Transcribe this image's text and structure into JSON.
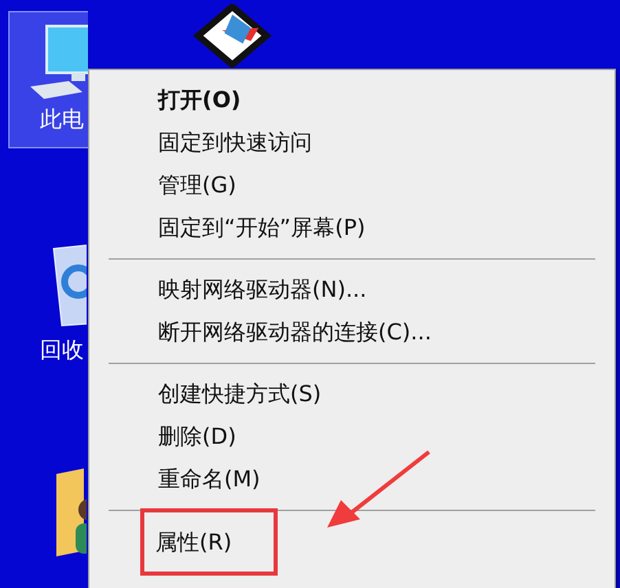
{
  "desktop_icons": [
    {
      "kind": "computer",
      "label": "此电",
      "selected": true
    },
    {
      "kind": "app",
      "selected": false
    },
    {
      "kind": "recycle-bin",
      "label": "回收",
      "selected": false
    },
    {
      "kind": "user-folder",
      "selected": false
    }
  ],
  "context_menu": {
    "items": [
      {
        "kind": "item",
        "label": "打开(O)",
        "default": true,
        "highlighted": false
      },
      {
        "kind": "item",
        "label": "固定到快速访问",
        "default": false,
        "highlighted": false
      },
      {
        "kind": "item",
        "label": "管理(G)",
        "default": false,
        "highlighted": false
      },
      {
        "kind": "item",
        "label": "固定到“开始”屏幕(P)",
        "default": false,
        "highlighted": false
      },
      {
        "kind": "separator"
      },
      {
        "kind": "item",
        "label": "映射网络驱动器(N)...",
        "default": false,
        "highlighted": false
      },
      {
        "kind": "item",
        "label": "断开网络驱动器的连接(C)...",
        "default": false,
        "highlighted": false
      },
      {
        "kind": "separator"
      },
      {
        "kind": "item",
        "label": "创建快捷方式(S)",
        "default": false,
        "highlighted": false
      },
      {
        "kind": "item",
        "label": "删除(D)",
        "default": false,
        "highlighted": false
      },
      {
        "kind": "item",
        "label": "重命名(M)",
        "default": false,
        "highlighted": false
      },
      {
        "kind": "separator"
      },
      {
        "kind": "item",
        "label": "属性(R)",
        "default": false,
        "highlighted": true
      }
    ]
  }
}
